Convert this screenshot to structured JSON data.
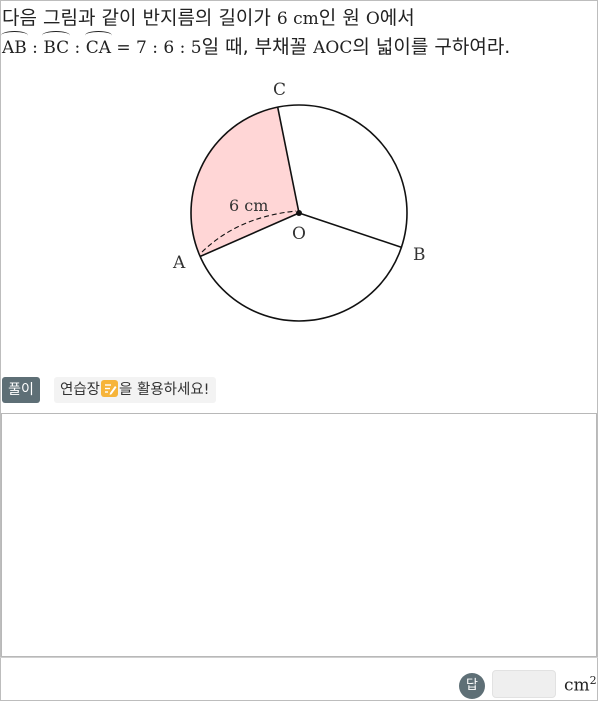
{
  "question": {
    "line1_a": "다음 그림과 같이 반지름의 길이가 ",
    "line1_radius": "6 cm",
    "line1_b": "인 원 ",
    "line1_center": "O",
    "line1_c": "에서",
    "arc_ab": "AB",
    "arc_bc": "BC",
    "arc_ca": "CA",
    "ratio_sep1": " : ",
    "ratio_sep2": " : ",
    "ratio_values": " = 7 : 6 : 5",
    "line2_b": "일 때, 부채꼴 ",
    "line2_sector": "AOC",
    "line2_c": "의 넓이를 구하여라."
  },
  "figure": {
    "label_c": "C",
    "label_a": "A",
    "label_b": "B",
    "label_o": "O",
    "radius_label": "6 cm",
    "shaded_color": "#ffd6d6"
  },
  "solution": {
    "badge": "풀이",
    "hint_before": "연습장",
    "hint_after": "을 활용하세요!"
  },
  "answer": {
    "badge": "답",
    "value": "",
    "unit": "cm",
    "unit_exp": "2"
  }
}
